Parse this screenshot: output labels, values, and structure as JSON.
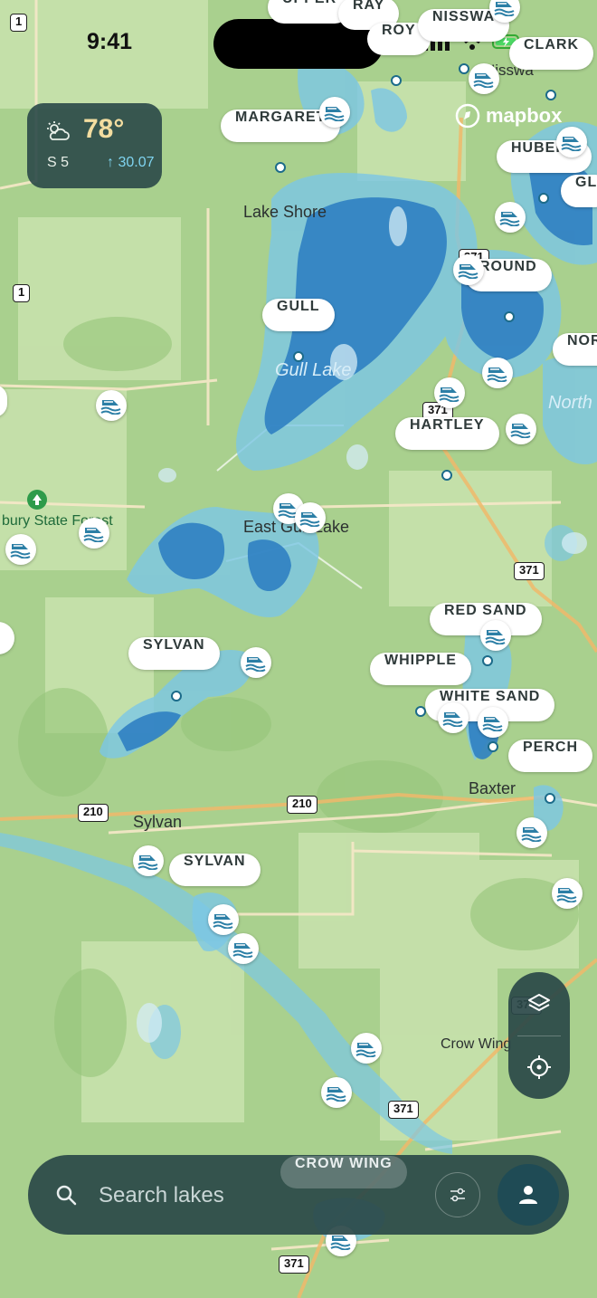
{
  "status_bar": {
    "time": "9:41"
  },
  "weather": {
    "temperature": "78°",
    "wind": "S 5",
    "pressure_arrow": "↑",
    "pressure": "30.07",
    "icon": "partly-cloudy-icon"
  },
  "attribution": {
    "brand": "mapbox"
  },
  "lake_labels": [
    {
      "id": "upper",
      "label": "UPPER"
    },
    {
      "id": "ray",
      "label": "RAY"
    },
    {
      "id": "roy",
      "label": "ROY"
    },
    {
      "id": "nisswa",
      "label": "NISSWA"
    },
    {
      "id": "clark",
      "label": "CLARK"
    },
    {
      "id": "margaret",
      "label": "MARGARET"
    },
    {
      "id": "hubert",
      "label": "HUBERT"
    },
    {
      "id": "gl",
      "label": "GL"
    },
    {
      "id": "round",
      "label": "ROUND"
    },
    {
      "id": "gull",
      "label": "GULL"
    },
    {
      "id": "nor",
      "label": "NOR"
    },
    {
      "id": "hartley",
      "label": "HARTLEY"
    },
    {
      "id": "red-sand",
      "label": "RED SAND"
    },
    {
      "id": "whipple",
      "label": "WHIPPLE"
    },
    {
      "id": "white-sand",
      "label": "WHITE SAND"
    },
    {
      "id": "perch",
      "label": "PERCH"
    },
    {
      "id": "sylvan-north",
      "label": "SYLVAN"
    },
    {
      "id": "sylvan-south",
      "label": "SYLVAN"
    },
    {
      "id": "crow-wing",
      "label": "CROW WING"
    }
  ],
  "place_labels": {
    "lake_shore": "Lake Shore",
    "gull_lake": "Gull Lake",
    "north": "North",
    "east_gull_lake": "East Gull Lake",
    "state_forest": "bury State Forest",
    "baxter": "Baxter",
    "sylvan": "Sylvan",
    "crow_wing": "Crow Wing",
    "nisswa_town": "Nisswa"
  },
  "road_shields": [
    "1",
    "1",
    "371",
    "371",
    "210",
    "210",
    "371",
    "371",
    "371",
    "371"
  ],
  "map_controls": {
    "layers_icon": "layers-icon",
    "locate_icon": "crosshair-icon"
  },
  "search": {
    "placeholder": "Search lakes",
    "value": ""
  },
  "colors": {
    "land": "#a9d08e",
    "water_deep": "#2f7fc2",
    "water_shallow": "#7cc7e6",
    "panel": "#2a4848",
    "weather_temp": "#f3dda0"
  }
}
